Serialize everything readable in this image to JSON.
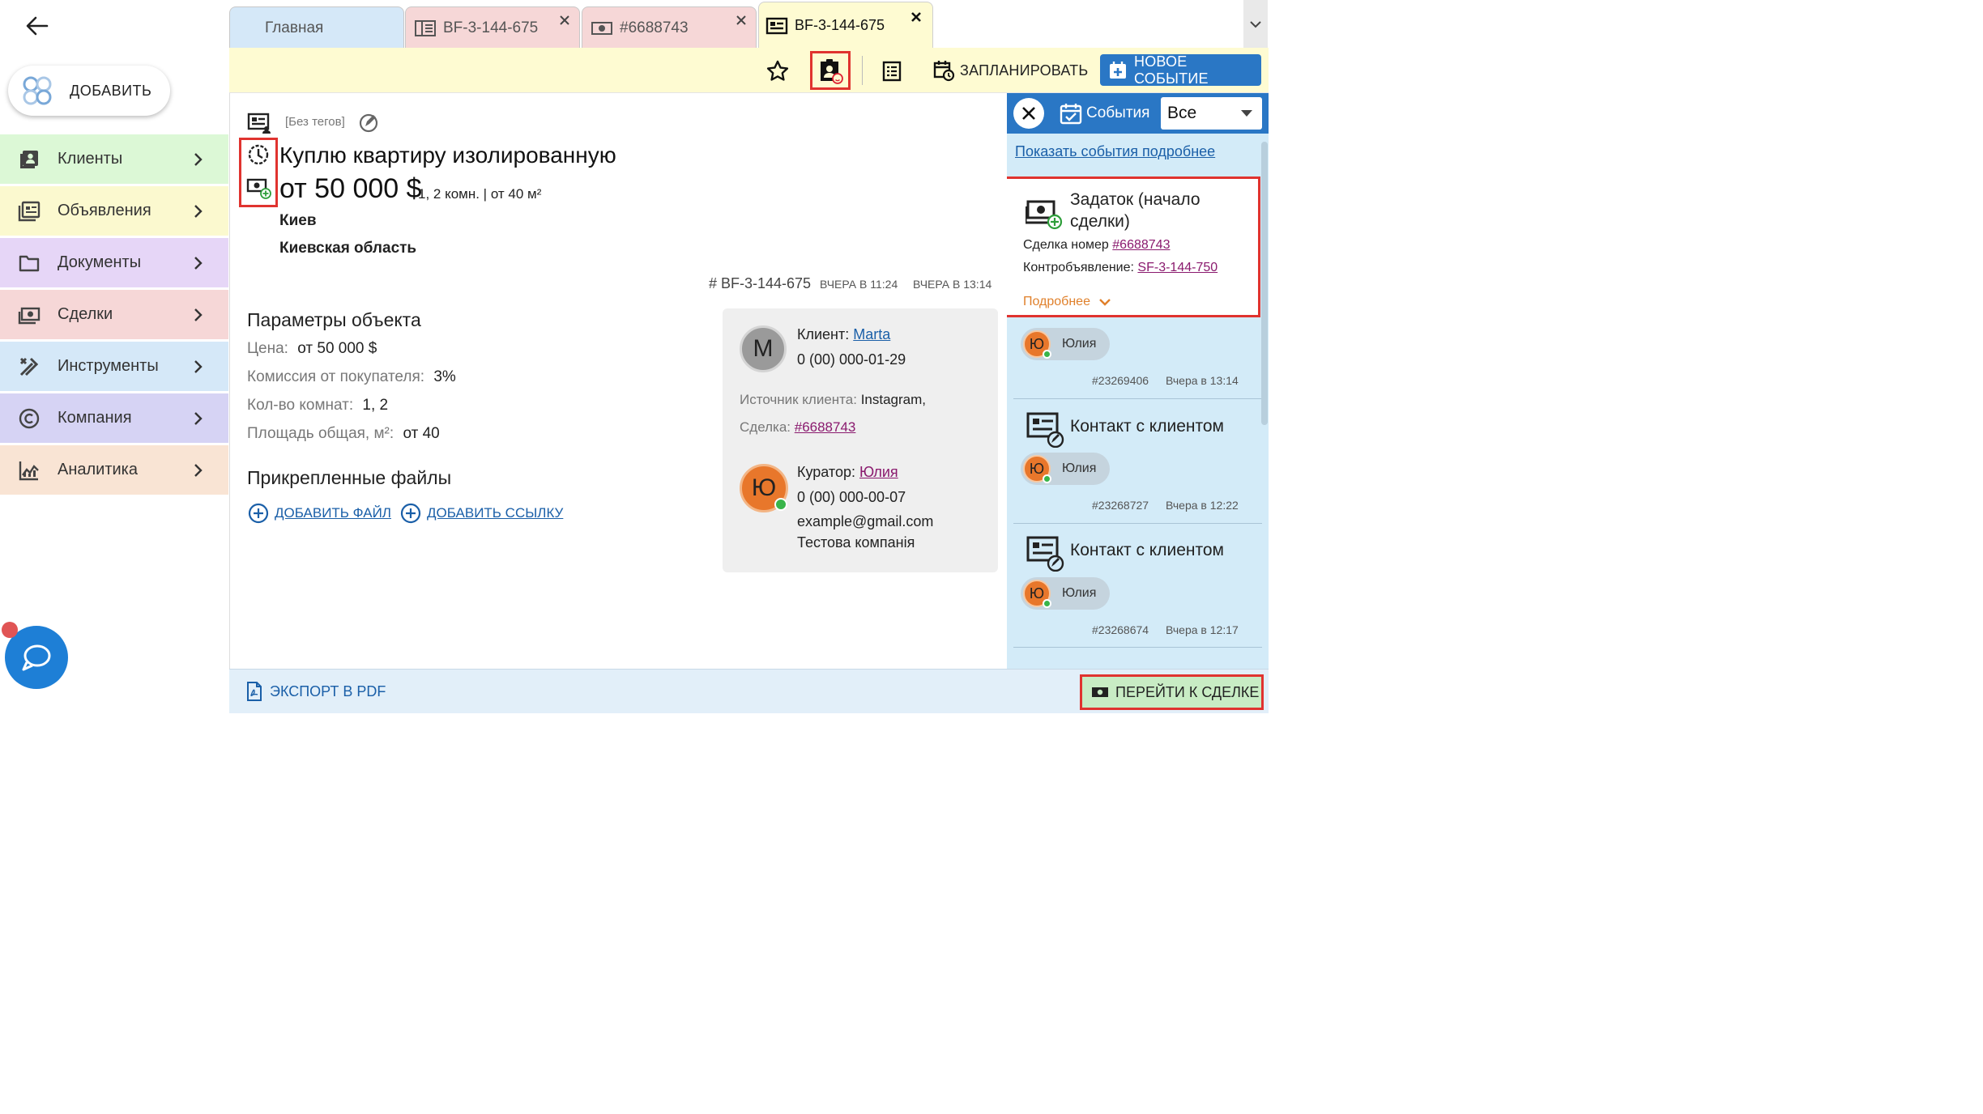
{
  "sidebar": {
    "add_label": "ДОБАВИТЬ",
    "items": [
      {
        "label": "Клиенты",
        "icon": "clients-icon",
        "color": "#dcf8d6"
      },
      {
        "label": "Объявления",
        "icon": "listings-icon",
        "color": "#fbf9cf"
      },
      {
        "label": "Документы",
        "icon": "folder-icon",
        "color": "#e6d6f7"
      },
      {
        "label": "Сделки",
        "icon": "money-icon",
        "color": "#f6d7d7"
      },
      {
        "label": "Инструменты",
        "icon": "tools-icon",
        "color": "#d5e8f8"
      },
      {
        "label": "Компания",
        "icon": "copyright-icon",
        "color": "#d6d3f4"
      },
      {
        "label": "Аналитика",
        "icon": "analytics-icon",
        "color": "#f9e4d4"
      }
    ]
  },
  "tabs": [
    {
      "label": "Главная",
      "color": "#d5e8f8"
    },
    {
      "label": "BF-3-144-675",
      "color": "#f6d7d7"
    },
    {
      "label": "#6688743",
      "color": "#f6d7d7"
    },
    {
      "label": "BF-3-144-675",
      "color": "#fefbd2"
    }
  ],
  "toolbar": {
    "schedule_label": "ЗАПЛАНИРОВАТЬ",
    "new_event_label": "НОВОЕ СОБЫТИЕ"
  },
  "listing": {
    "tags": "[Без тегов]",
    "title": "Куплю квартиру изолированную",
    "price": "от 50 000 $",
    "summary": "1, 2 комн. | от 40 м²",
    "city": "Киев",
    "region": "Киевская область",
    "code": "# BF-3-144-675",
    "created": "ВЧЕРА В 11:24",
    "updated": "ВЧЕРА В 13:14"
  },
  "params": {
    "heading": "Параметры объекта",
    "rows": [
      {
        "label": "Цена:",
        "value": "от 50 000 $"
      },
      {
        "label": "Комиссия от покупателя:",
        "value": "3%"
      },
      {
        "label": "Кол-во комнат:",
        "value": "1, 2"
      },
      {
        "label": "Площадь общая, м²:",
        "value": "от 40"
      }
    ]
  },
  "files": {
    "heading": "Прикрепленные файлы",
    "add_file": "ДОБАВИТЬ ФАЙЛ",
    "add_link": "ДОБАВИТЬ ССЫЛКУ"
  },
  "contact": {
    "client_initial": "М",
    "client_label": "Клиент:",
    "client_name": "Marta",
    "client_phone": "0 (00) 000-01-29",
    "source_label": "Источник клиента:",
    "source_value": "Instagram,",
    "deal_label": "Сделка:",
    "deal_value": "#6688743",
    "curator_initial": "Ю",
    "curator_label": "Куратор:",
    "curator_name": "Юлия",
    "curator_phone": "0 (00) 000-00-07",
    "curator_email": "example@gmail.com",
    "curator_company": "Тестова компанія"
  },
  "events": {
    "title": "События",
    "filter": "Все",
    "details_link": "Показать события подробнее",
    "deposit": {
      "title": "Задаток (начало сделки)",
      "deal_label": "Сделка номер",
      "deal_value": "#6688743",
      "counter_label": "Контробъявление:",
      "counter_value": "SF-3-144-750",
      "more": "Подробнее",
      "user_initial": "Ю",
      "user_name": "Юлия",
      "id": "#23269406",
      "time": "Вчера в 13:14"
    },
    "items": [
      {
        "title": "Контакт с клиентом",
        "user_initial": "Ю",
        "user_name": "Юлия",
        "id": "#23268727",
        "time": "Вчера в 12:22"
      },
      {
        "title": "Контакт с клиентом",
        "user_initial": "Ю",
        "user_name": "Юлия",
        "id": "#23268674",
        "time": "Вчера в 12:17"
      }
    ]
  },
  "footer": {
    "export_label": "ЭКСПОРТ В PDF",
    "goto_deal_label": "ПЕРЕЙТИ К СДЕЛКЕ"
  },
  "colors": {
    "accent_blue": "#2a77c5",
    "highlight_red": "#e0332f",
    "toolbar_yellow": "#fefbd2",
    "events_bg": "#d3ebf8",
    "avatar_orange": "#e8772b"
  }
}
